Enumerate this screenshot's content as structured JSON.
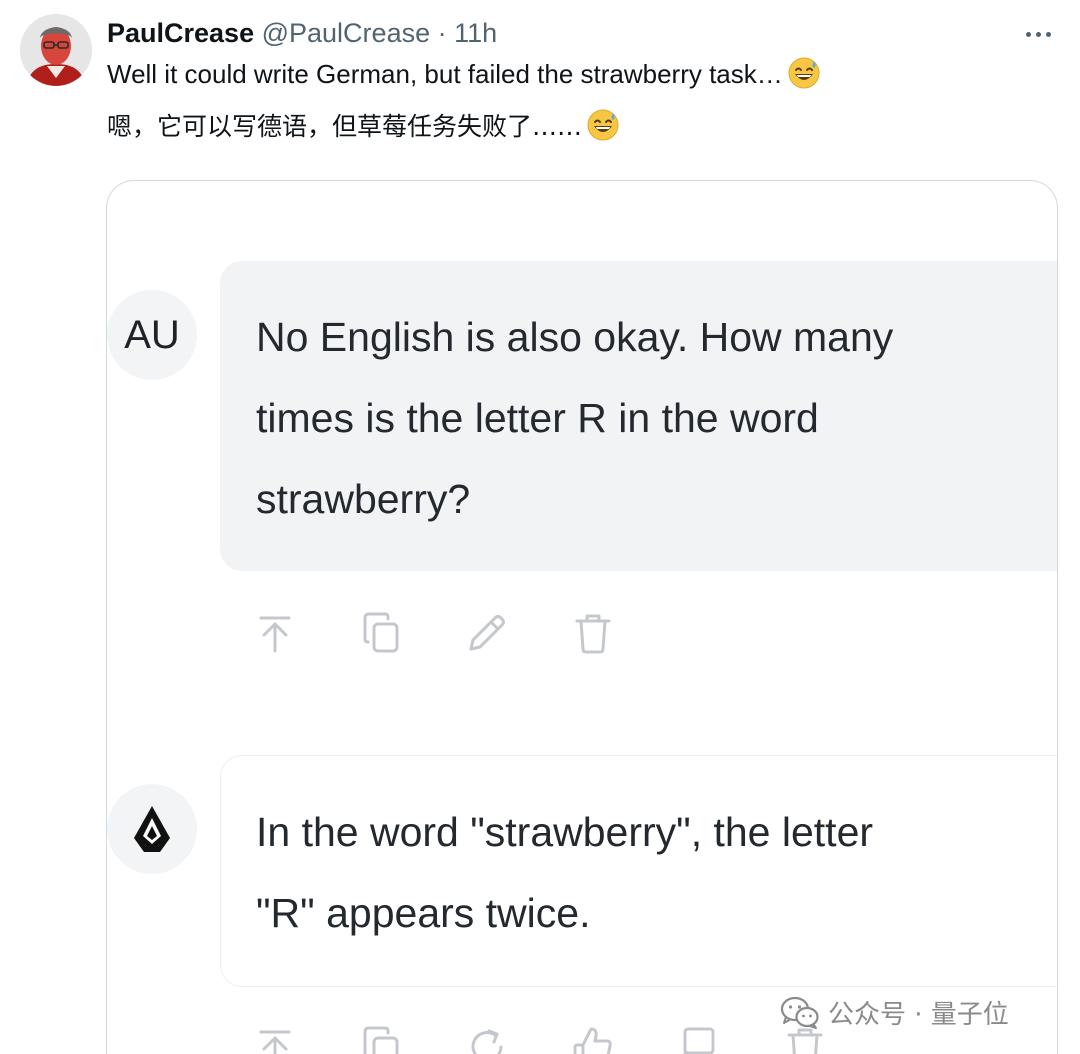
{
  "tweet": {
    "author_name": "PaulCrease",
    "author_handle": "@PaulCrease",
    "separator": "·",
    "time_ago": "11h",
    "text_en": "Well it could write German, but failed the strawberry task…",
    "text_zh": "嗯，它可以写德语，但草莓任务失败了……",
    "emoji": "sweat-smile-emoji"
  },
  "chat": {
    "user_avatar_initials": "AU",
    "user_message_lines": [
      "No English is also okay. How many",
      "times is the letter R in the word",
      "strawberry?"
    ],
    "user_actions": [
      "move-to-top-icon",
      "copy-icon",
      "edit-icon",
      "delete-icon"
    ],
    "bot_avatar_icon": "assistant-logo-icon",
    "bot_message_lines": [
      "In the word \"strawberry\", the letter",
      "\"R\" appears twice."
    ],
    "bot_actions": [
      "move-to-top-icon",
      "copy-icon",
      "regenerate-icon",
      "thumbs-up-icon",
      "flag-icon",
      "delete-icon"
    ]
  },
  "watermark": {
    "text": "公众号 · 量子位",
    "icon": "wechat-icon"
  },
  "colors": {
    "name": "#0f1419",
    "meta": "#536471",
    "bubble_user": "#f2f3f5",
    "icon_gray": "#c4c8ce"
  }
}
